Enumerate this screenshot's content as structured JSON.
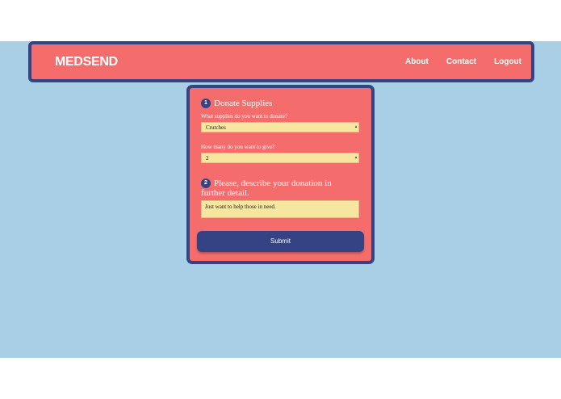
{
  "navbar": {
    "brand": "MEDSEND",
    "links": [
      {
        "label": "About"
      },
      {
        "label": "Contact"
      },
      {
        "label": "Logout"
      }
    ]
  },
  "form": {
    "step1": {
      "number": "1",
      "title": "Donate Supplies",
      "supplies_label": "What supplies do you want to donate?",
      "supplies_value": "Crutches",
      "quantity_label": "How many do you want to give?",
      "quantity_value": "2"
    },
    "step2": {
      "number": "2",
      "title": "Please, describe your donation in further detail.",
      "description_value": "Just want to help those in need."
    },
    "submit_label": "Submit"
  },
  "colors": {
    "background": "#a8cfe5",
    "primary": "#f56c6c",
    "accent": "#354385",
    "input": "#f7e6a0"
  }
}
